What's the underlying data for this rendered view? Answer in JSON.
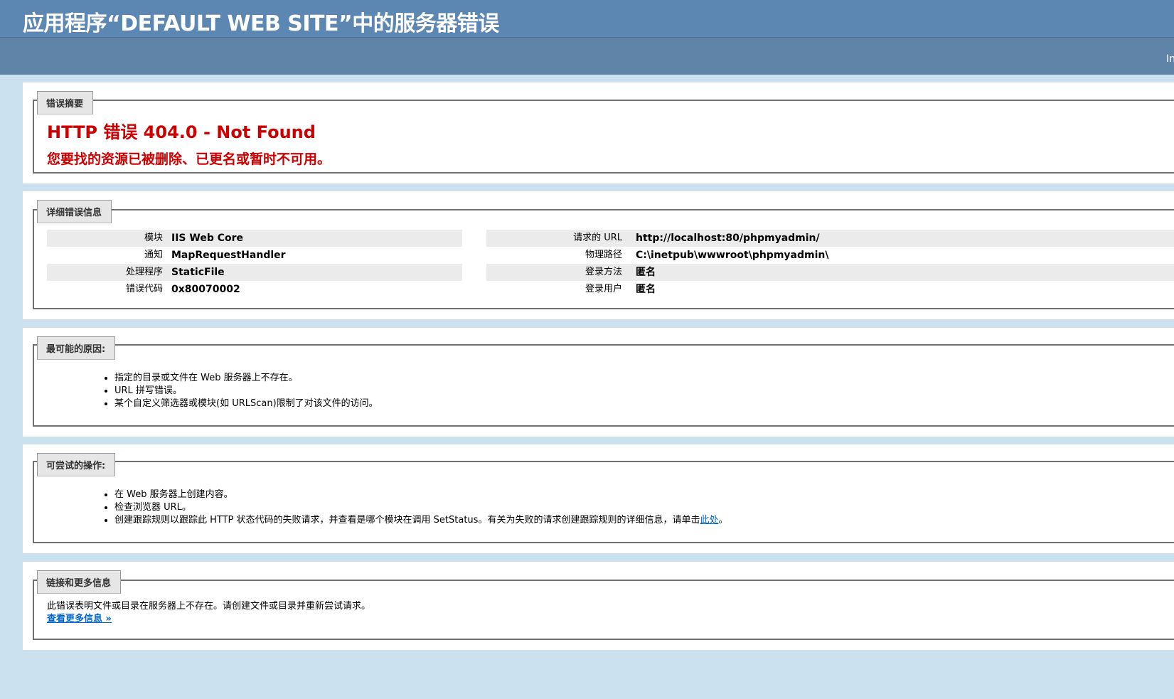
{
  "header": {
    "title": "应用程序“DEFAULT WEB SITE”中的服务器错误",
    "edge_text": "In"
  },
  "summary": {
    "legend": "错误摘要",
    "error_title": "HTTP 错误 404.0 - Not Found",
    "error_message": "您要找的资源已被删除、已更名或暂时不可用。"
  },
  "details": {
    "legend": "详细错误信息",
    "left": [
      {
        "key": "模块",
        "value": "IIS Web Core"
      },
      {
        "key": "通知",
        "value": "MapRequestHandler"
      },
      {
        "key": "处理程序",
        "value": "StaticFile"
      },
      {
        "key": "错误代码",
        "value": "0x80070002"
      }
    ],
    "right": [
      {
        "key": "请求的 URL",
        "value": "http://localhost:80/phpmyadmin/"
      },
      {
        "key": "物理路径",
        "value": "C:\\inetpub\\wwwroot\\phpmyadmin\\"
      },
      {
        "key": "登录方法",
        "value": "匿名"
      },
      {
        "key": "登录用户",
        "value": "匿名"
      }
    ]
  },
  "causes": {
    "legend": "最可能的原因:",
    "items": [
      "指定的目录或文件在 Web 服务器上不存在。",
      "URL 拼写错误。",
      "某个自定义筛选器或模块(如 URLScan)限制了对该文件的访问。"
    ]
  },
  "actions": {
    "legend": "可尝试的操作:",
    "items": [
      "在 Web 服务器上创建内容。",
      "检查浏览器 URL。"
    ],
    "trace_text": "创建跟踪规则以跟踪此 HTTP 状态代码的失败请求，并查看是哪个模块在调用 SetStatus。有关为失败的请求创建跟踪规则的详细信息，请单击",
    "trace_link": "此处",
    "trace_end": "。"
  },
  "links": {
    "legend": "链接和更多信息",
    "text": "此错误表明文件或目录在服务器上不存在。请创建文件或目录并重新尝试请求。",
    "more_link": "查看更多信息 »"
  }
}
